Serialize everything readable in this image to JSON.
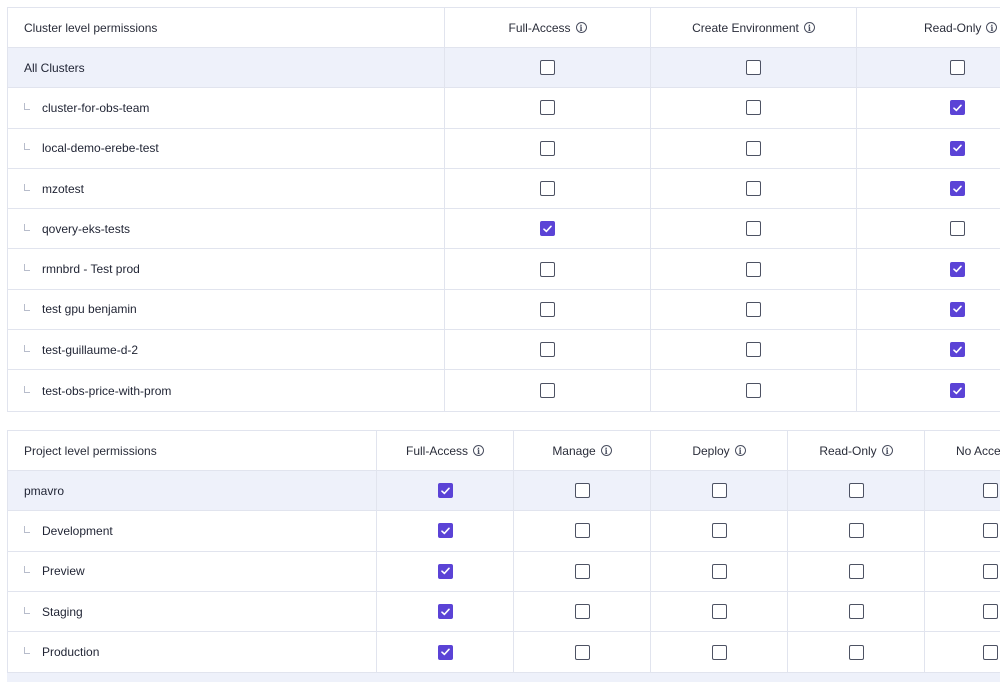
{
  "cluster_permissions": {
    "header": {
      "title": "Cluster level permissions",
      "columns": [
        "Full-Access",
        "Create Environment",
        "Read-Only"
      ]
    },
    "group": {
      "label": "All Clusters",
      "values": [
        false,
        false,
        false
      ]
    },
    "rows": [
      {
        "label": "cluster-for-obs-team",
        "values": [
          false,
          false,
          true
        ]
      },
      {
        "label": "local-demo-erebe-test",
        "values": [
          false,
          false,
          true
        ]
      },
      {
        "label": "mzotest",
        "values": [
          false,
          false,
          true
        ]
      },
      {
        "label": "qovery-eks-tests",
        "values": [
          true,
          false,
          false
        ]
      },
      {
        "label": "rmnbrd - Test prod",
        "values": [
          false,
          false,
          true
        ]
      },
      {
        "label": "test gpu benjamin",
        "values": [
          false,
          false,
          true
        ]
      },
      {
        "label": "test-guillaume-d-2",
        "values": [
          false,
          false,
          true
        ]
      },
      {
        "label": "test-obs-price-with-prom",
        "values": [
          false,
          false,
          true
        ]
      }
    ]
  },
  "project_permissions": {
    "header": {
      "title": "Project level permissions",
      "columns": [
        "Full-Access",
        "Manage",
        "Deploy",
        "Read-Only",
        "No Acce"
      ]
    },
    "group": {
      "label": "pmavro",
      "values": [
        true,
        false,
        false,
        false,
        false
      ]
    },
    "rows": [
      {
        "label": "Development",
        "values": [
          true,
          false,
          false,
          false,
          false
        ]
      },
      {
        "label": "Preview",
        "values": [
          true,
          false,
          false,
          false,
          false
        ]
      },
      {
        "label": "Staging",
        "values": [
          true,
          false,
          false,
          false,
          false
        ]
      },
      {
        "label": "Production",
        "values": [
          true,
          false,
          false,
          false,
          false
        ]
      }
    ]
  },
  "icons": {
    "info": "info-icon",
    "check": "checkmark-icon",
    "branch": "tree-branch-icon"
  },
  "colors": {
    "accent": "#5b43d6",
    "group_bg": "#eef1fa",
    "border": "#e1e4ee"
  }
}
